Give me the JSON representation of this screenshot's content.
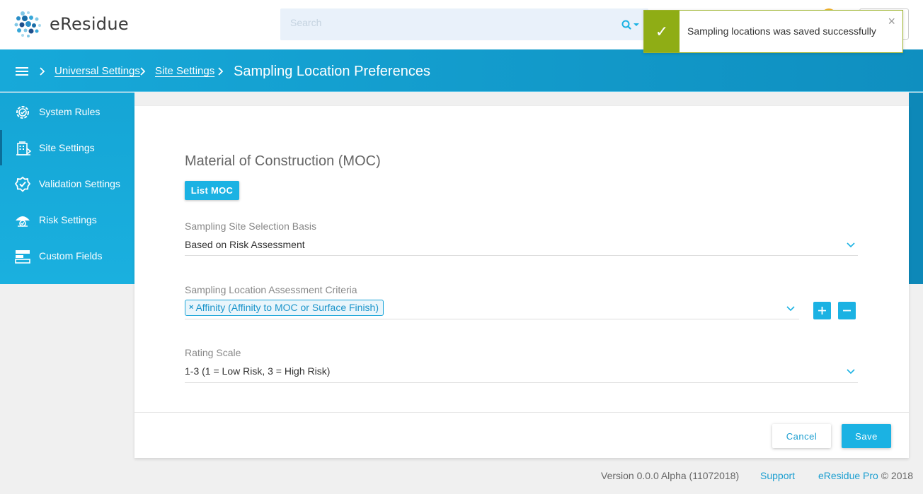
{
  "app": {
    "name": "eResidue"
  },
  "search": {
    "placeholder": "Search"
  },
  "toast": {
    "message": "Sampling locations was saved successfully"
  },
  "breadcrumb": {
    "items": [
      "Universal Settings",
      "Site Settings"
    ],
    "current": "Sampling Location Preferences"
  },
  "sidebar": {
    "items": [
      {
        "label": "System Rules",
        "icon": "gear-check-icon"
      },
      {
        "label": "Site Settings",
        "icon": "building-icon"
      },
      {
        "label": "Validation Settings",
        "icon": "badge-check-icon"
      },
      {
        "label": "Risk Settings",
        "icon": "risk-umbrella-icon"
      },
      {
        "label": "Custom Fields",
        "icon": "fields-icon"
      }
    ],
    "active_index": 1
  },
  "form": {
    "section_title": "Material of Construction (MOC)",
    "list_moc_label": "List MOC",
    "selection_basis": {
      "label": "Sampling Site Selection Basis",
      "value": "Based on Risk Assessment"
    },
    "assessment_criteria": {
      "label": "Sampling Location Assessment Criteria",
      "tags": [
        "Affinity (Affinity to MOC or Surface Finish)"
      ]
    },
    "rating_scale": {
      "label": "Rating Scale",
      "value": "1-3 (1 = Low Risk, 3 = High Risk)"
    },
    "cancel_label": "Cancel",
    "save_label": "Save"
  },
  "footer": {
    "version": "Version 0.0.0 Alpha (11072018)",
    "support": "Support",
    "brand": "eResidue Pro",
    "copyright": " © 2018"
  },
  "colors": {
    "accent": "#1bb2e3",
    "success": "#8fad15",
    "link": "#1b9ed0"
  }
}
